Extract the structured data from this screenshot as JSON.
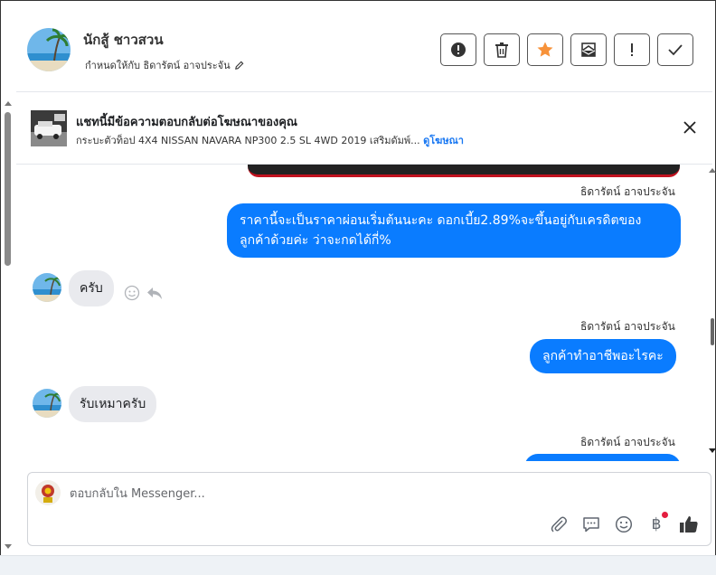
{
  "header": {
    "contact_name": "นักสู้ ชาวสวน",
    "assigned_to": "กำหนดให้กับ ธิดารัตน์ อาจประจัน",
    "actions": [
      {
        "icon": "alert-circle-icon"
      },
      {
        "icon": "trash-icon"
      },
      {
        "icon": "star-icon"
      },
      {
        "icon": "mark-unread-icon"
      },
      {
        "icon": "exclamation-icon"
      },
      {
        "icon": "check-icon"
      }
    ],
    "accent_star": "#f7923a"
  },
  "ad": {
    "title": "แชทนี้มีข้อความตอบกลับต่อโฆษณาของคุณ",
    "subtitle": "กระบะตัวท็อป 4X4 NISSAN NAVARA NP300 2.5 SL 4WD 2019 เสริมดัมพ์...",
    "link": "ดูโฆษณา"
  },
  "messages": {
    "sender_1": "ธิดารัตน์ อาจประจัน",
    "out_1": "ราคานี้จะเป็นราคาผ่อนเริ่มต้นนะคะ ดอกเบี้ย2.89%จะขึ้นอยู่กับเครดิตของลูกค้าด้วยค่ะ ว่าจะกดได้กี่%",
    "in_1": "ครับ",
    "sender_2": "ธิดารัตน์ อาจประจัน",
    "out_2": "ลูกค้าทำอาชีพอะไรคะ",
    "in_2": "รับเหมาครับ",
    "sender_3": "ธิดารัตน์ อาจประจัน"
  },
  "composer": {
    "placeholder": "ตอบกลับใน Messenger...",
    "currency_symbol": "฿"
  },
  "colors": {
    "outgoing_bubble": "#0a7cff",
    "incoming_bubble": "#e9eaee",
    "link": "#1877f2"
  }
}
